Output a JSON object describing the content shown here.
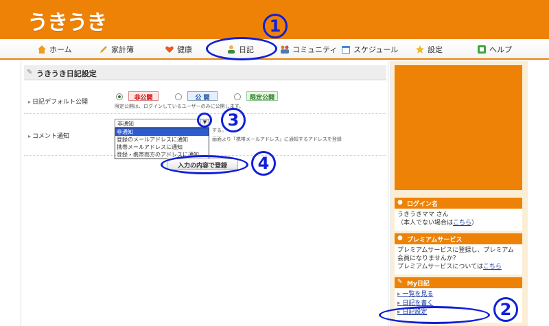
{
  "header": {
    "logo": "うきうき"
  },
  "nav": {
    "items": [
      {
        "label": "ホーム"
      },
      {
        "label": "家計簿"
      },
      {
        "label": "健康"
      },
      {
        "label": "日記"
      },
      {
        "label": "コミュニティ"
      },
      {
        "label": "スケジュール"
      },
      {
        "label": "設定"
      },
      {
        "label": "ヘルプ"
      }
    ]
  },
  "main": {
    "title": "うきうき日記設定",
    "default_public": {
      "label": "日記デフォルト公開",
      "options": [
        "非公開",
        "公 開",
        "限定公開"
      ],
      "note": "限定公開は、ログインしているユーザーのみに公開します。"
    },
    "comment_notify": {
      "label": "コメント通知",
      "selected": "非通知",
      "options": [
        "非通知",
        "登録のメールアドレスに通知",
        "携帯メールアドレスに通知",
        "登録・携帯両方のアドレスに通知"
      ],
      "note1": "する。",
      "note2": "画面より「携帯メールアドレス」に通知するアドレスを登録"
    },
    "submit_label": "入力の内容で登録"
  },
  "sidebar": {
    "login": {
      "heading": "ログイン名",
      "name": "うきうきママ さん",
      "not_you_prefix": "（本人でない場合は",
      "not_you_link": "こちら",
      "not_you_suffix": "）"
    },
    "premium": {
      "heading": "プレミアムサービス",
      "text1": "プレミアムサービスに登録し、プレミアム会員になりませんか？",
      "text2_prefix": "プレミアムサービスについては",
      "text2_link": "こちら"
    },
    "my_diary": {
      "heading": "My日記",
      "links": [
        "一覧を見る",
        "日記を書く",
        "日記設定"
      ]
    }
  },
  "annotations": [
    "1",
    "2",
    "3",
    "4"
  ],
  "colors": {
    "brand": "#ee8206",
    "annotation": "#1020d8"
  }
}
